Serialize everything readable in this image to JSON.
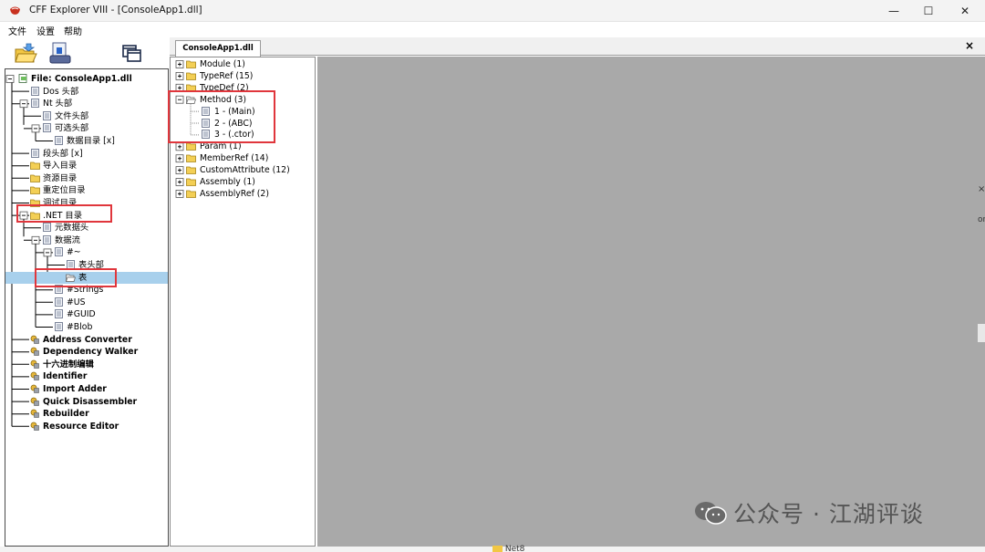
{
  "window": {
    "title": "CFF Explorer VIII - [ConsoleApp1.dll]",
    "minimize_glyph": "—",
    "maximize_glyph": "☐",
    "close_glyph": "✕"
  },
  "menu": [
    "文件",
    "设置",
    "帮助"
  ],
  "toolbar": {
    "icons": [
      "open-file-icon",
      "save-file-icon",
      "windows-icon"
    ]
  },
  "tabs": {
    "active": "ConsoleApp1.dll",
    "close_glyph": "×"
  },
  "left_tree": [
    {
      "label": "File: ConsoleApp1.dll",
      "bold": true,
      "icon": "file-icon"
    },
    {
      "label": "Dos 头部",
      "icon": "page-icon"
    },
    {
      "label": "Nt 头部",
      "icon": "page-icon"
    },
    {
      "label": "文件头部",
      "icon": "page-icon"
    },
    {
      "label": "可选头部",
      "icon": "page-icon"
    },
    {
      "label": "数据目录 [x]",
      "icon": "page-icon"
    },
    {
      "label": "段头部 [x]",
      "icon": "page-icon"
    },
    {
      "label": "导入目录",
      "icon": "folder-icon"
    },
    {
      "label": "资源目录",
      "icon": "folder-icon"
    },
    {
      "label": "重定位目录",
      "icon": "folder-icon"
    },
    {
      "label": "调试目录",
      "icon": "folder-icon"
    },
    {
      "label": ".NET 目录",
      "icon": "folder-icon"
    },
    {
      "label": "元数据头",
      "icon": "page-icon"
    },
    {
      "label": "数据流",
      "icon": "page-icon"
    },
    {
      "label": "#~",
      "icon": "page-icon"
    },
    {
      "label": "表头部",
      "icon": "page-icon"
    },
    {
      "label": "表",
      "icon": "folder-open-icon"
    },
    {
      "label": "#Strings",
      "icon": "page-icon"
    },
    {
      "label": "#US",
      "icon": "page-icon"
    },
    {
      "label": "#GUID",
      "icon": "page-icon"
    },
    {
      "label": "#Blob",
      "icon": "page-icon"
    },
    {
      "label": "Address Converter",
      "bold": true,
      "icon": "tool-icon"
    },
    {
      "label": "Dependency Walker",
      "bold": true,
      "icon": "tool-icon"
    },
    {
      "label": "十六进制编辑",
      "bold": true,
      "icon": "tool-icon"
    },
    {
      "label": "Identifier",
      "bold": true,
      "icon": "tool-icon"
    },
    {
      "label": "Import Adder",
      "bold": true,
      "icon": "tool-icon"
    },
    {
      "label": "Quick Disassembler",
      "bold": true,
      "icon": "tool-icon"
    },
    {
      "label": "Rebuilder",
      "bold": true,
      "icon": "tool-icon"
    },
    {
      "label": "Resource Editor",
      "bold": true,
      "icon": "tool-icon"
    }
  ],
  "table_tree": [
    {
      "label": "Module (1)",
      "icon": "folder-icon"
    },
    {
      "label": "TypeRef (15)",
      "icon": "folder-icon"
    },
    {
      "label": "TypeDef (2)",
      "icon": "folder-icon"
    },
    {
      "label": "Method (3)",
      "icon": "folder-open-icon"
    },
    {
      "label": "1 - (Main)",
      "icon": "page-icon"
    },
    {
      "label": "2 - (ABC)",
      "icon": "page-icon"
    },
    {
      "label": "3 - (.ctor)",
      "icon": "page-icon"
    },
    {
      "label": "Param (1)",
      "icon": "folder-icon"
    },
    {
      "label": "MemberRef (14)",
      "icon": "folder-icon"
    },
    {
      "label": "CustomAttribute (12)",
      "icon": "folder-icon"
    },
    {
      "label": "Assembly (1)",
      "icon": "folder-icon"
    },
    {
      "label": "AssemblyRef (2)",
      "icon": "folder-icon"
    }
  ],
  "watermark": {
    "icon": "wechat-icon",
    "text": "公众号 · 江湖评谈"
  },
  "background_fragments": {
    "folder": "Net8",
    "close_glyph": "×",
    "partial_text": "or"
  },
  "colors": {
    "selection": "#a8d0ec",
    "highlight_box": "#e0363c",
    "content_area": "#a9a9a9"
  }
}
